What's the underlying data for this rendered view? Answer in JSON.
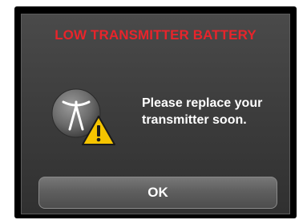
{
  "dialog": {
    "title": "LOW TRANSMITTER BATTERY",
    "message_line1": "Please replace your",
    "message_line2": "transmitter soon.",
    "ok_label": "OK"
  },
  "icons": {
    "transmitter": "antenna-icon",
    "warning": "warning-triangle-icon"
  },
  "colors": {
    "title": "#e8242b",
    "warning_fill": "#f5c400",
    "background": "#3b3b3b",
    "text": "#ffffff"
  }
}
